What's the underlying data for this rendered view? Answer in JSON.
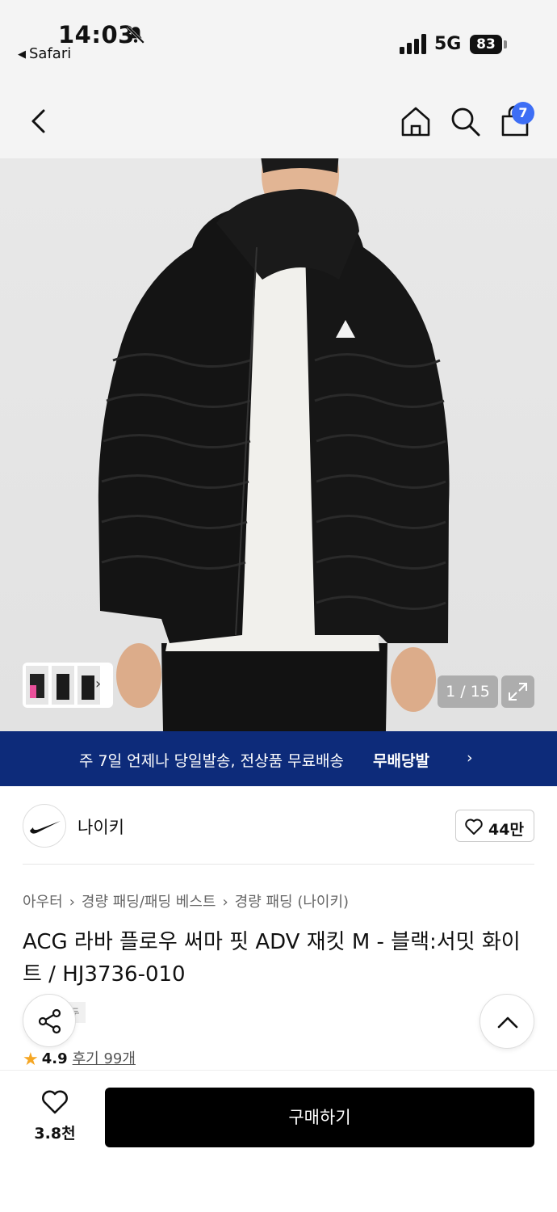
{
  "status": {
    "time": "14:03",
    "back_app": "Safari",
    "network": "5G",
    "battery": "83"
  },
  "nav": {
    "cart_count": "7"
  },
  "gallery": {
    "counter": "1 / 15"
  },
  "banner": {
    "text": "주 7일 언제나 당일발송, 전상품 무료배송",
    "logo": "무배당발",
    "chevron": "›"
  },
  "brand": {
    "name": "나이키",
    "likes": "44만"
  },
  "breadcrumb": {
    "items": [
      "아우터",
      "경량 패딩/패딩 베스트",
      "경량 패딩 (나이키)"
    ],
    "sep": "›"
  },
  "product": {
    "title": "ACG 라바 플로우 써마 핏 ADV 재킷 M - 블랙:서밋 화이트 / HJ3736-010",
    "tag": "두",
    "rating": "4.9",
    "reviews": "후기 99개"
  },
  "bottom": {
    "wish_count": "3.8천",
    "buy_label": "구매하기"
  },
  "colors": {
    "banner_bg": "#0d2b7a",
    "badge": "#3d6ef5",
    "star": "#f5a623",
    "buy_bg": "#000000"
  }
}
